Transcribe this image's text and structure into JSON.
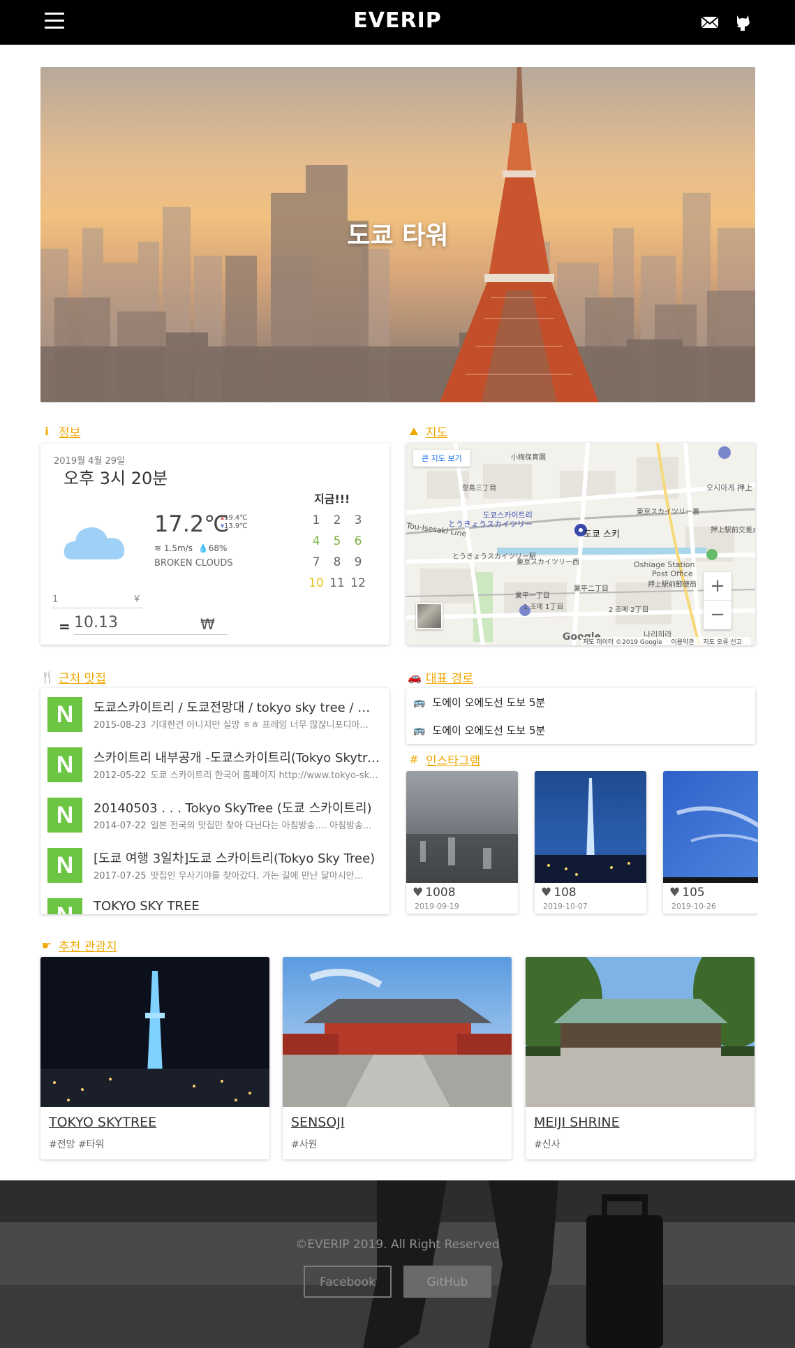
{
  "navbar": {
    "brand": "EVERIP",
    "menu_icon": "hamburger-menu-icon",
    "mail_icon": "envelope-icon",
    "github_icon": "github-octocat-icon"
  },
  "hero": {
    "title": "도쿄 타워"
  },
  "info": {
    "heading": "정보",
    "date": "2019월 4월 29일",
    "time": "오후 3시 20분",
    "weather_icon": "cloud-icon",
    "temperature": "17.2℃",
    "temp_high": "19.4℃",
    "temp_low": "13.9℃",
    "wind": "1.5m/s",
    "humidity": "68%",
    "description": "BROKEN CLOUDS",
    "now_label": "지금!!!",
    "hours": [
      "1",
      "2",
      "3",
      "4",
      "5",
      "6",
      "7",
      "8",
      "9",
      "10",
      "11",
      "12"
    ],
    "currency_input": "1",
    "currency_from": "¥",
    "currency_result": "10.13",
    "currency_to": "₩",
    "equals": "="
  },
  "map": {
    "heading": "지도",
    "larger_map_button": "큰 지도 보기",
    "pin_label": "도쿄 스키",
    "labels": [
      "도쿄스카이트리",
      "とうきょうスカイツリー",
      "Oshiage Station",
      "Post Office",
      "押上駅前郵便局",
      "Tou-Isesaki Line",
      "小梅保育園",
      "향島三丁目",
      "東京スカイツリー裏",
      "押上駅前交差点",
      "とうきょうスカイツリー駅",
      "東京スカイツリー西",
      "業平一丁目",
      "業平二丁目",
      "1 조메 1丁目",
      "2 조메 2丁目",
      "오시아게 押上",
      "나리히라"
    ],
    "zoom_in": "+",
    "zoom_out": "−",
    "google": "Google",
    "footer": [
      "지도 데이터 ©2019 Google",
      "이용약관",
      "지도 오류 신고"
    ]
  },
  "restaurants": {
    "heading": "근처 맛집",
    "logo_text": "N",
    "items": [
      {
        "title": "도쿄스카이트리 / 도쿄전망대 / tokyo sky tree / 아사쿠사",
        "date": "2015-08-23",
        "snippet": "기대한건 아니지만 실망 ㅎㅎ 프레임 너무 많잖니포디아..."
      },
      {
        "title": "스카이트리 내부공개 -도쿄스카이트리(Tokyo Skytree)",
        "date": "2012-05-22",
        "snippet": "도쿄 스카이트리 한국어 홈페이지 http://www.tokyo-skytree..."
      },
      {
        "title": "20140503 .  .  . Tokyo SkyTree (도쿄 스카이트리)",
        "date": "2014-07-22",
        "snippet": "일본 전국의 맛집만 찾아 다닌다는 아침방송.... 아침방송..."
      },
      {
        "title": "[도쿄 여행 3일차]도쿄 스카이트리(Tokyo Sky Tree)",
        "date": "2017-07-25",
        "snippet": "맛집인 우사기야를 찾아갔다. 가는 길에 만난 달마시안..."
      },
      {
        "title": "TOKYO SKY TREE",
        "date": "",
        "snippet": ""
      }
    ]
  },
  "route": {
    "heading": "대표 경로",
    "items": [
      "도에이 오에도선 도보 5분",
      "도에이 오에도선 도보 5분"
    ]
  },
  "instagram": {
    "heading": "인스타그램",
    "posts": [
      {
        "likes": "1008",
        "date": "2019-09-19"
      },
      {
        "likes": "108",
        "date": "2019-10-07"
      },
      {
        "likes": "105",
        "date": "2019-10-26"
      }
    ]
  },
  "recommended": {
    "heading": "추천 관광지",
    "items": [
      {
        "name": "TOKYO SKYTREE",
        "tags": "#전망 #타워"
      },
      {
        "name": "SENSOJI",
        "tags": "#사원"
      },
      {
        "name": "MEIJI SHRINE",
        "tags": "#신사"
      }
    ]
  },
  "footer": {
    "copyright": "©EVERIP 2019. All Right Reserved",
    "facebook": "Facebook",
    "github": "GitHub"
  },
  "colors": {
    "accent": "#f0a800",
    "naver_green": "#6cc644",
    "navbar": "#000000"
  }
}
